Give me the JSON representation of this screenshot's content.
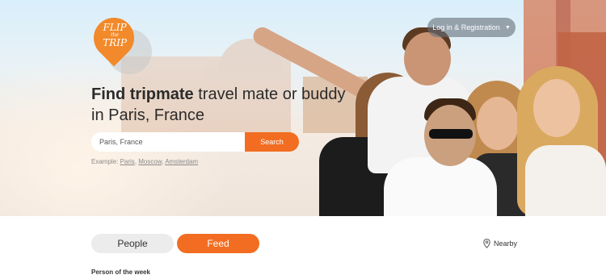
{
  "logo": {
    "line1": "FLIP",
    "line2": "the",
    "line3": "TRIP"
  },
  "header": {
    "login_label": "Log in & Registration"
  },
  "hero": {
    "headline_bold": "Find tripmate",
    "headline_rest": " travel mate or buddy in Paris, France"
  },
  "search": {
    "value": "Paris, France",
    "placeholder": "Paris, France",
    "button_label": "Search",
    "example_prefix": "Example: ",
    "examples": [
      "Paris",
      "Moscow",
      "Amsterdam"
    ]
  },
  "tabs": {
    "people": "People",
    "feed": "Feed"
  },
  "nearby_label": "Nearby",
  "section_title": "Person of the week",
  "colors": {
    "accent": "#f26d21",
    "login_bg": "#6b747c"
  }
}
